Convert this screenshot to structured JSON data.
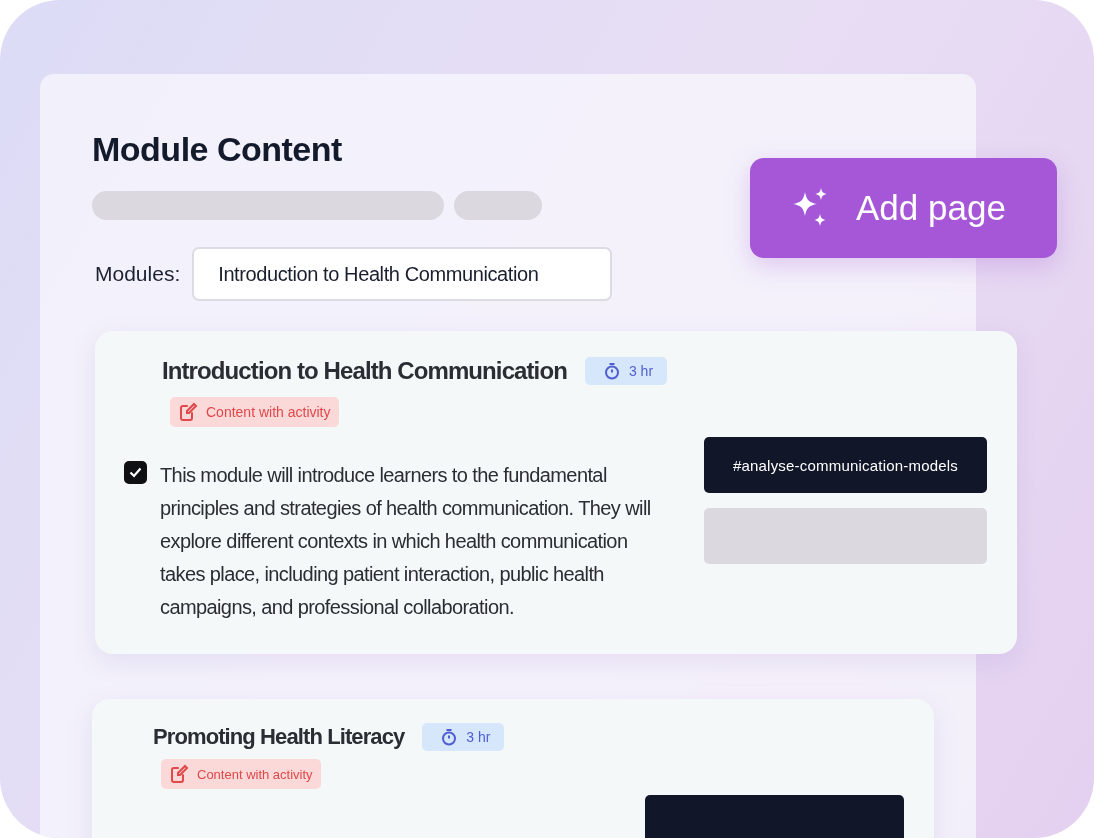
{
  "header": {
    "title": "Module Content"
  },
  "add_button": {
    "label": "Add page"
  },
  "modules_field": {
    "label": "Modules:",
    "value": "Introduction to Health Communication"
  },
  "modules": [
    {
      "title": "Introduction to Health Communication",
      "duration": "3 hr",
      "tag": "Content with activity",
      "checked": true,
      "description": "This module will introduce learners to the fundamental principles and strategies of health communication. They will explore different contexts in which health communication takes place, including patient interaction, public health campaigns, and professional collaboration.",
      "hashtag": "#analyse-communication-models"
    },
    {
      "title": "Promoting Health Literacy",
      "duration": "3 hr",
      "tag": "Content with activity"
    }
  ]
}
